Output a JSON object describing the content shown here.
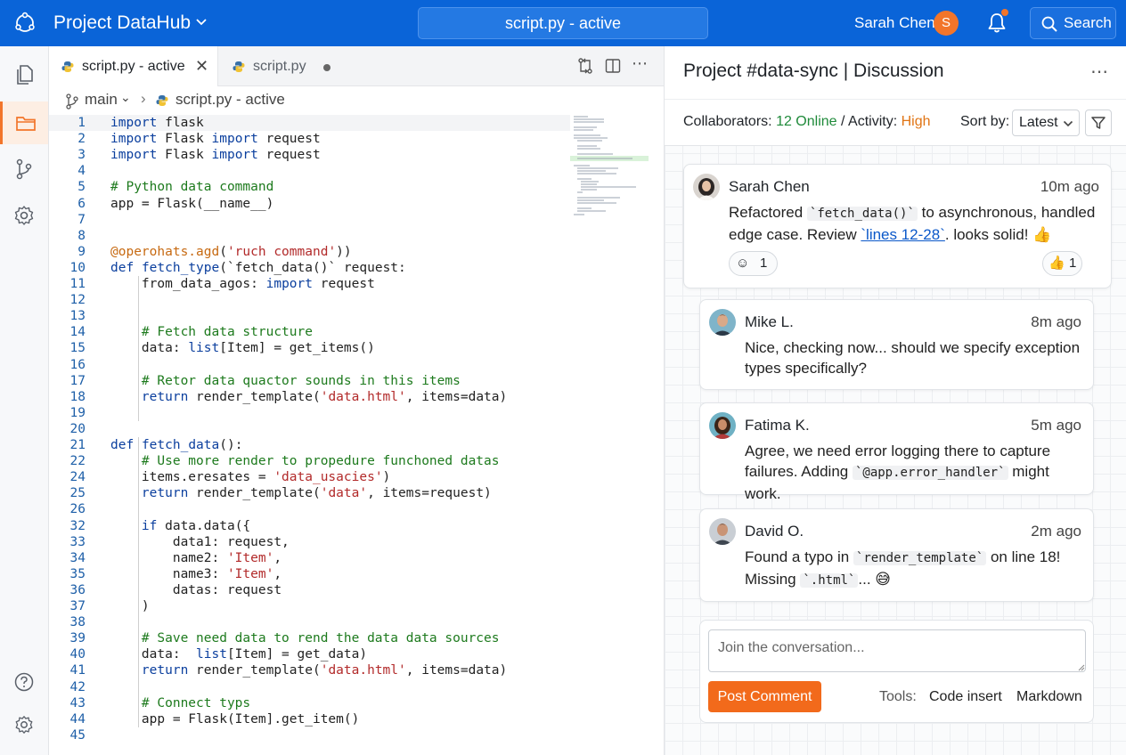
{
  "topbar": {
    "app_title": "Project DataHub",
    "center_title": "script.py - active",
    "user_name": "Sarah Chen",
    "user_initial": "S",
    "search_label": "Search",
    "bell_icon": "bell-icon",
    "notification_color": "#f2752a"
  },
  "activity_bar": {
    "items": [
      {
        "icon": "files-icon",
        "active": false
      },
      {
        "icon": "folder-icon",
        "active": true
      },
      {
        "icon": "git-branch-icon",
        "active": false
      },
      {
        "icon": "gear-icon",
        "active": false
      }
    ],
    "bottom": [
      {
        "icon": "help-icon"
      },
      {
        "icon": "settings-icon"
      }
    ]
  },
  "editor": {
    "tabs": [
      {
        "label": "script.py - active",
        "active": true
      },
      {
        "label": "script.py",
        "active": false
      }
    ],
    "breadcrumb": {
      "branch": "main",
      "file": "script.py - active"
    },
    "lines": [
      {
        "n": "1",
        "code": "import flask"
      },
      {
        "n": "2",
        "code": "import Flask import request"
      },
      {
        "n": "3",
        "code": "import Flask import request"
      },
      {
        "n": "4",
        "code": ""
      },
      {
        "n": "5",
        "code": "# Python data command"
      },
      {
        "n": "6",
        "code": "app = Flask(__name__)"
      },
      {
        "n": "7",
        "code": ""
      },
      {
        "n": "8",
        "code": ""
      },
      {
        "n": "9",
        "code": "@operohats.agd('ruch command'))"
      },
      {
        "n": "10",
        "code": "def fetch_type(`fetch_data()` request:"
      },
      {
        "n": "11",
        "code": "    from_data_agos: import request"
      },
      {
        "n": "12",
        "code": ""
      },
      {
        "n": "13",
        "code": ""
      },
      {
        "n": "14",
        "code": "    # Fetch data structure"
      },
      {
        "n": "15",
        "code": "    data: list[Item] = get_items()"
      },
      {
        "n": "16",
        "code": ""
      },
      {
        "n": "17",
        "code": "    # Retor data quactor sounds in this items"
      },
      {
        "n": "18",
        "code": "    return render_template('data.html', items=data)"
      },
      {
        "n": "19",
        "code": ""
      },
      {
        "n": "20",
        "code": ""
      },
      {
        "n": "21",
        "code": "def fetch_data():"
      },
      {
        "n": "22",
        "code": "    # Use more render to propedure funchoned datas"
      },
      {
        "n": "24",
        "code": "    items.eresates = 'data_usacies')"
      },
      {
        "n": "25",
        "code": "    return render_template('data', items=request)"
      },
      {
        "n": "26",
        "code": ""
      },
      {
        "n": "32",
        "code": "    if data.data({"
      },
      {
        "n": "33",
        "code": "        data1: request,"
      },
      {
        "n": "34",
        "code": "        name2: 'Item',"
      },
      {
        "n": "35",
        "code": "        name3: 'Item',"
      },
      {
        "n": "36",
        "code": "        datas: request"
      },
      {
        "n": "37",
        "code": "    )"
      },
      {
        "n": "38",
        "code": ""
      },
      {
        "n": "39",
        "code": "    # Save need data to rend the data data sources"
      },
      {
        "n": "40",
        "code": "    data:  list[Item] = get_data)"
      },
      {
        "n": "41",
        "code": "    return render_template('data.html', items=data)"
      },
      {
        "n": "42",
        "code": ""
      },
      {
        "n": "43",
        "code": "    # Connect typs"
      },
      {
        "n": "44",
        "code": "    app = Flask(Item].get_item()"
      },
      {
        "n": "45",
        "code": ""
      }
    ]
  },
  "panel": {
    "title": "Project #data-sync | Discussion",
    "collab_label": "Collaborators:",
    "online": "12 Online",
    "separator": "/",
    "activity_label": "Activity:",
    "activity_value": "High",
    "sort_label": "Sort by:",
    "sort_value": "Latest",
    "colors": {
      "online": "#1f8a3a",
      "activity": "#e07414",
      "accent": "#f26a1b"
    }
  },
  "comments": [
    {
      "author": "Sarah Chen",
      "time": "10m ago",
      "parts": [
        "Refactored ",
        "`fetch_data()`",
        " to asynchronous, handled edge case. Review ",
        "`lines 12-28`",
        ". looks solid! 👍"
      ],
      "reactions": [
        {
          "emoji": "☺",
          "count": "1"
        },
        {
          "emoji": "👍",
          "count": "1"
        }
      ]
    },
    {
      "author": "Mike L.",
      "time": "8m ago",
      "parts": [
        "Nice, checking now... should we specify exception types specifically?"
      ]
    },
    {
      "author": "Fatima K.",
      "time": "5m ago",
      "parts": [
        "Agree, we need error logging there to capture failures. Adding ",
        "`@app.error_handler`",
        " might work."
      ]
    },
    {
      "author": "David O.",
      "time": "2m ago",
      "parts": [
        "Found a typo in ",
        "`render_template`",
        " on line 18! Missing ",
        "`.html`",
        "... 😅"
      ]
    }
  ],
  "composer": {
    "placeholder": "Join the conversation...",
    "post_label": "Post Comment",
    "tools_label": "Tools:",
    "tool_code": "Code insert",
    "tool_markdown": "Markdown"
  }
}
